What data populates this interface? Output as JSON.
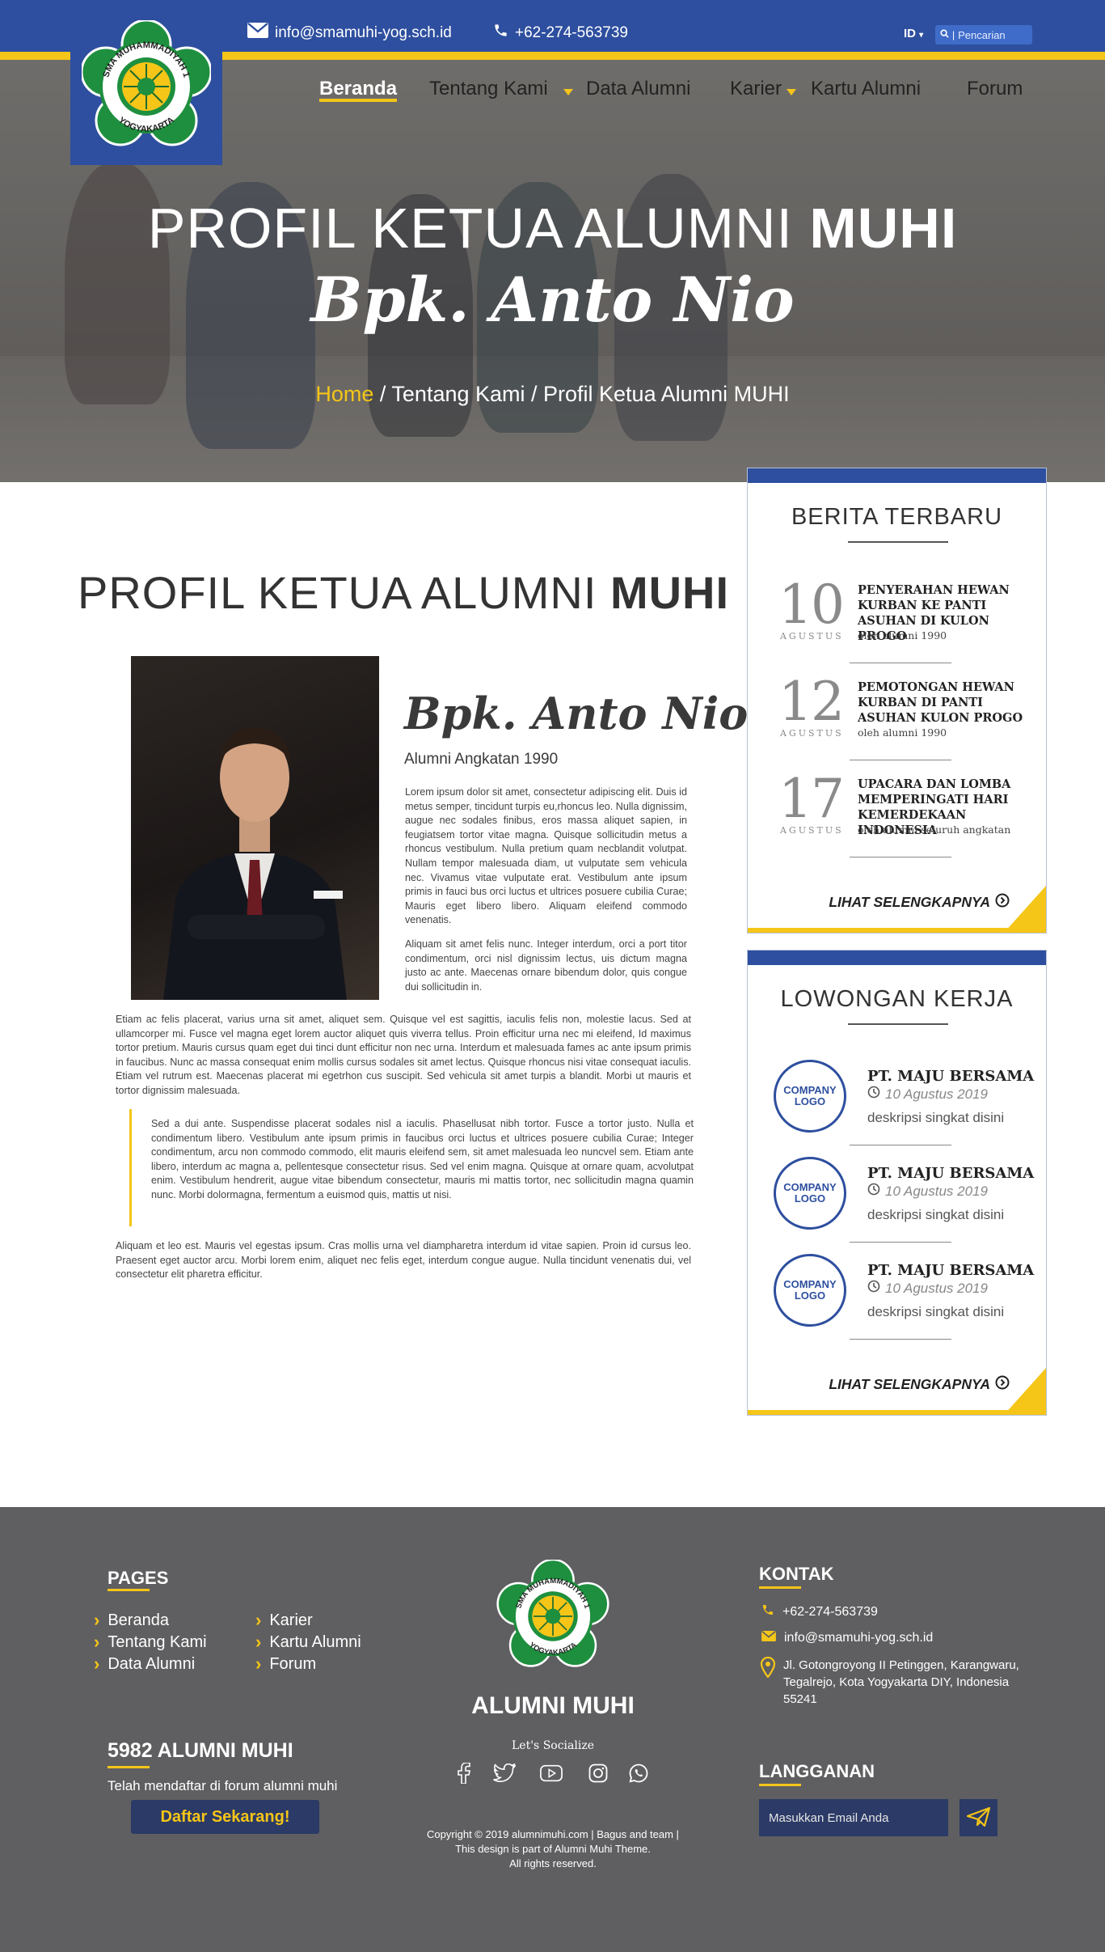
{
  "header": {
    "email": "info@smamuhi-yog.sch.id",
    "phone": "+62-274-563739",
    "lang": "ID",
    "search_placeholder": "Pencarian",
    "logo_text_top": "SMA MUHAMMADIYAH 1",
    "logo_text_bottom": "YOGYAKARTA"
  },
  "nav": {
    "items": [
      {
        "label": "Beranda",
        "active": true
      },
      {
        "label": "Tentang Kami"
      },
      {
        "label": "Data Alumni"
      },
      {
        "label": "Karier"
      },
      {
        "label": "Kartu Alumni"
      },
      {
        "label": "Forum"
      }
    ]
  },
  "hero": {
    "title_light": "PROFIL KETUA ALUMNI ",
    "title_bold": "MUHI",
    "name": "Bpk. Anto Nio",
    "breadcrumb_home": "Home",
    "breadcrumb_rest": " / Tentang Kami / Profil Ketua Alumni MUHI"
  },
  "main": {
    "title_light": "PROFIL KETUA ALUMNI ",
    "title_bold": "MUHI",
    "profile_name": "Bpk. Anto Nio",
    "profile_sub": "Alumni Angkatan 1990",
    "p1": "Lorem ipsum dolor sit amet, consectetur adipiscing elit. Duis id metus semper, tincidunt turpis eu,rhoncus leo. Nulla dignissim, augue nec sodales finibus, eros massa aliquet sapien, in feugiatsem tortor vitae magna. Quisque sollicitudin metus a rhoncus vestibulum. Nulla pretium quam necblandit volutpat. Nullam tempor malesuada diam, ut vulputate sem vehicula nec. Vivamus vitae vulputate erat. Vestibulum ante ipsum primis in fauci bus orci luctus et ultrices posuere cubilia Curae; Mauris eget libero libero. Aliquam eleifend commodo venenatis.",
    "p2": "Aliquam sit amet felis nunc. Integer interdum, orci a port titor condimentum, orci nisl dignissim lectus, uis dictum magna justo ac ante. Maecenas ornare bibendum dolor, quis congue dui sollicitudin in.",
    "p3": "Etiam ac felis placerat, varius urna sit amet, aliquet sem. Quisque vel est sagittis, iaculis felis non, molestie lacus. Sed at ullamcorper mi. Fusce vel magna eget lorem auctor aliquet quis viverra tellus. Proin efficitur urna nec mi eleifend, Id maximus tortor pretium. Mauris cursus quam eget dui tinci dunt efficitur non nec urna. Interdum et malesuada fames ac ante ipsum primis in faucibus. Nunc ac massa consequat enim mollis cursus sodales sit amet lectus. Quisque rhoncus nisi vitae consequat iaculis. Etiam vel rutrum est. Maecenas placerat mi egetrhon cus suscipit. Sed vehicula sit amet turpis a blandit. Morbi ut mauris et tortor dignissim malesuada.",
    "quote": "Sed a dui ante. Suspendisse placerat sodales nisl a iaculis. Phasellusat nibh tortor. Fusce a tortor justo. Nulla et condimentum libero. Vestibulum ante ipsum primis in faucibus orci luctus et ultrices posuere cubilia Curae; Integer condimentum, arcu non commodo commodo, elit mauris eleifend sem, sit amet malesuada leo nuncvel sem. Etiam ante libero, interdum ac magna a, pellentesque consectetur risus. Sed vel enim magna. Quisque at ornare quam, acvolutpat enim. Vestibulum hendrerit, augue vitae bibendum consectetur, mauris mi mattis tortor, nec sollicitudin magna quamin nunc. Morbi dolormagna, fermentum a euismod quis, mattis ut nisi.",
    "p4": "Aliquam et leo est. Mauris vel egestas ipsum. Cras mollis urna vel diampharetra interdum id vitae sapien. Proin id cursus leo. Praesent eget auctor arcu. Morbi lorem enim, aliquet nec felis eget, interdum congue augue. Nulla tincidunt venenatis dui, vel consectetur elit pharetra efficitur."
  },
  "news": {
    "title": "BERITA TERBARU",
    "items": [
      {
        "day": "10",
        "month": "AGUSTUS",
        "title": "PENYERAHAN HEWAN KURBAN KE PANTI ASUHAN DI KULON PROGO",
        "by": "oleh alumni 1990"
      },
      {
        "day": "12",
        "month": "AGUSTUS",
        "title": "PEMOTONGAN HEWAN KURBAN DI PANTI ASUHAN KULON PROGO",
        "by": "oleh alumni 1990"
      },
      {
        "day": "17",
        "month": "AGUSTUS",
        "title": "UPACARA DAN LOMBA MEMPERINGATI HARI KEMERDEKAAN INDONESIA",
        "by": "oleh alumni seluruh angkatan"
      }
    ],
    "more": "LIHAT SELENGKAPNYA"
  },
  "jobs": {
    "title": "LOWONGAN KERJA",
    "logo_label": "COMPANY LOGO",
    "items": [
      {
        "company": "PT. MAJU BERSAMA",
        "date": "10 Agustus 2019",
        "desc": "deskripsi singkat disini"
      },
      {
        "company": "PT. MAJU BERSAMA",
        "date": "10 Agustus 2019",
        "desc": "deskripsi singkat disini"
      },
      {
        "company": "PT. MAJU BERSAMA",
        "date": "10 Agustus 2019",
        "desc": "deskripsi singkat disini"
      }
    ],
    "more": "LIHAT SELENGKAPNYA"
  },
  "footer": {
    "pages_title": "PAGES",
    "pages_col1": [
      "Beranda",
      "Tentang Kami",
      "Data Alumni"
    ],
    "pages_col2": [
      "Karier",
      "Kartu Alumni",
      "Forum"
    ],
    "count_title": "5982 ALUMNI MUHI",
    "count_sub": "Telah mendaftar di forum alumni muhi",
    "register_btn": "Daftar Sekarang!",
    "brand": "ALUMNI MUHI",
    "socialize": "Let's Socialize",
    "copyright_1": "Copyright © 2019 alumnimuhi.com | Bagus and team |",
    "copyright_2": "This design is part of Alumni Muhi Theme.",
    "copyright_3": "All rights reserved.",
    "contact_title": "KONTAK",
    "contact_phone": "+62-274-563739",
    "contact_email": "info@smamuhi-yog.sch.id",
    "contact_address": "Jl. Gotongroyong II Petinggen, Karangwaru, Tegalrejo, Kota Yogyakarta DIY, Indonesia 55241",
    "subscribe_title": "LANGGANAN",
    "subscribe_placeholder": "Masukkan Email Anda"
  },
  "colors": {
    "primary_blue": "#2e4f9f",
    "accent_yellow": "#f5c518",
    "footer_bg": "#5f5f61",
    "dark_navy": "#2b3a66"
  },
  "icons": [
    "envelope-icon",
    "phone-icon",
    "search-icon",
    "chevron-right-icon",
    "clock-icon",
    "map-pin-icon",
    "facebook-icon",
    "twitter-icon",
    "youtube-icon",
    "instagram-icon",
    "whatsapp-icon",
    "paper-plane-icon"
  ]
}
